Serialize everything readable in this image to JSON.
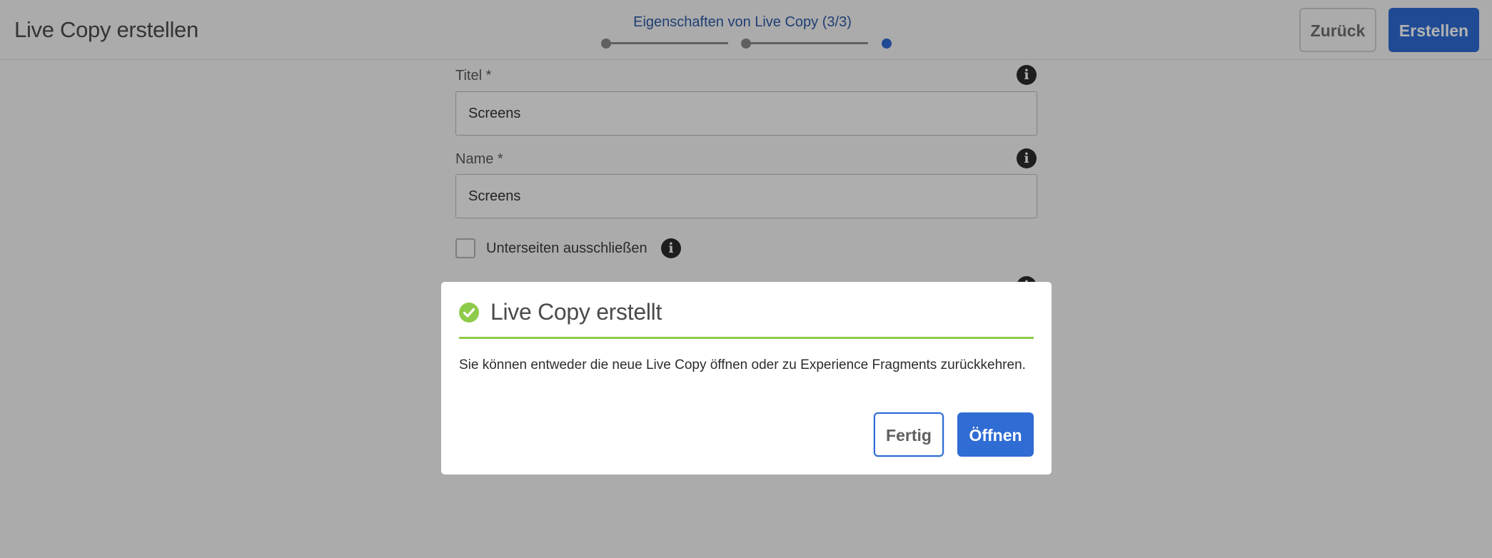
{
  "header": {
    "app_title": "Live Copy erstellen",
    "wizard_title": "Eigenschaften von Live Copy (3/3)",
    "back_label": "Zurück",
    "create_label": "Erstellen"
  },
  "form": {
    "title_label": "Titel *",
    "title_value": "Screens",
    "name_label": "Name *",
    "name_value": "Screens",
    "exclude_subpages_label": "Unterseiten ausschließen",
    "info_glyph": "i"
  },
  "dialog": {
    "title": "Live Copy erstellt",
    "message": "Sie können entweder die neue Live Copy öffnen oder zu Experience Fragments zurückkehren.",
    "done_label": "Fertig",
    "open_label": "Öffnen"
  },
  "icons": {
    "success": "checkmark-circle-icon",
    "info": "info-icon"
  },
  "colors": {
    "accent": "#2f6cd4",
    "success": "#8ecb4a",
    "wizard_text": "#2d5aa6"
  }
}
